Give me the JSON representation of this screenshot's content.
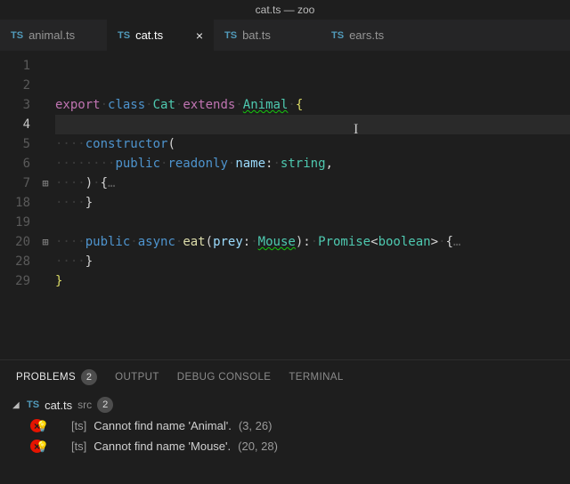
{
  "window": {
    "title": "cat.ts — zoo"
  },
  "tabs": [
    {
      "label": "animal.ts",
      "active": false
    },
    {
      "label": "cat.ts",
      "active": true
    },
    {
      "label": "bat.ts",
      "active": false
    },
    {
      "label": "ears.ts",
      "active": false
    }
  ],
  "editor": {
    "line_numbers": [
      "1",
      "2",
      "3",
      "4",
      "5",
      "6",
      "7",
      "18",
      "19",
      "20",
      "28",
      "29"
    ],
    "current_line_index": 3,
    "fold_markers": {
      "7": "⊞",
      "20": "⊞"
    },
    "tokens": {
      "export": "export",
      "class": "class",
      "Cat": "Cat",
      "extends": "extends",
      "Animal": "Animal",
      "constructor": "constructor",
      "public": "public",
      "readonly": "readonly",
      "name": "name",
      "string": "string",
      "async": "async",
      "eat": "eat",
      "prey": "prey",
      "Mouse": "Mouse",
      "Promise": "Promise",
      "boolean": "boolean",
      "ellipsis": "…"
    }
  },
  "panel": {
    "tabs": {
      "problems": "PROBLEMS",
      "output": "OUTPUT",
      "debug": "DEBUG CONSOLE",
      "terminal": "TERMINAL",
      "problem_count": "2"
    },
    "file": {
      "name": "cat.ts",
      "src": "src",
      "count": "2"
    },
    "items": [
      {
        "prefix": "[ts]",
        "msg": "Cannot find name 'Animal'.",
        "loc": "(3, 26)"
      },
      {
        "prefix": "[ts]",
        "msg": "Cannot find name 'Mouse'.",
        "loc": "(20, 28)"
      }
    ]
  }
}
